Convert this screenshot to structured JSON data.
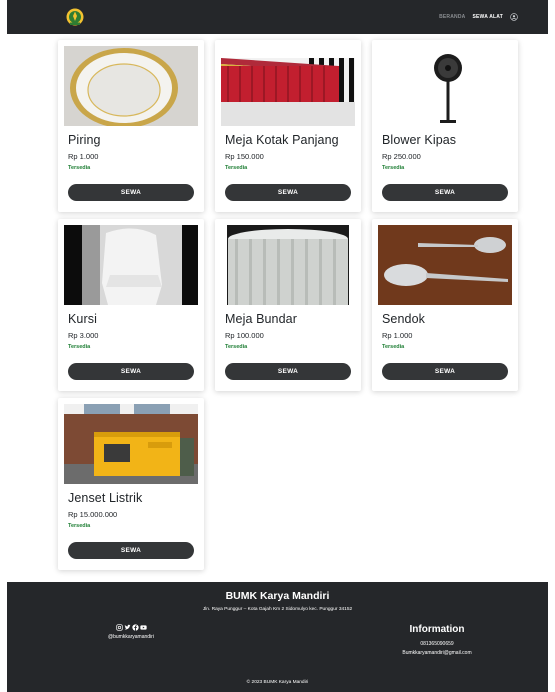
{
  "nav": {
    "links": [
      {
        "label": "BERANDA",
        "active": false
      },
      {
        "label": "SEWA ALAT",
        "active": true
      }
    ]
  },
  "products": [
    {
      "name": "Piring",
      "price": "Rp 1.000",
      "status": "Tersedia",
      "button": "SEWA",
      "image": "plate"
    },
    {
      "name": "Meja Kotak Panjang",
      "price": "Rp 150.000",
      "status": "Tersedia",
      "button": "SEWA",
      "image": "long-table"
    },
    {
      "name": "Blower Kipas",
      "price": "Rp 250.000",
      "status": "Tersedia",
      "button": "SEWA",
      "image": "fan"
    },
    {
      "name": "Kursi",
      "price": "Rp 3.000",
      "status": "Tersedia",
      "button": "SEWA",
      "image": "chair"
    },
    {
      "name": "Meja Bundar",
      "price": "Rp 100.000",
      "status": "Tersedia",
      "button": "SEWA",
      "image": "round-table"
    },
    {
      "name": "Sendok",
      "price": "Rp 1.000",
      "status": "Tersedia",
      "button": "SEWA",
      "image": "spoon"
    },
    {
      "name": "Jenset Listrik",
      "price": "Rp 15.000.000",
      "status": "Tersedia",
      "button": "SEWA",
      "image": "generator"
    }
  ],
  "footer": {
    "title": "BUMK Karya Mandiri",
    "address": "Jln. Raya Punggur – Kota Gajah Km 2 Sidomulyo kec. Punggur 34152",
    "social_handle": "@bumkkaryamandiri",
    "info_title": "Information",
    "phone": "081365090659",
    "email": "Bumkkaryamandiri@gmail.com",
    "copyright": "© 2023 BUMK Karya Mandiri"
  },
  "colors": {
    "navbar_bg": "#25272a",
    "button_bg": "#343638",
    "status_green": "#1e7e34"
  }
}
